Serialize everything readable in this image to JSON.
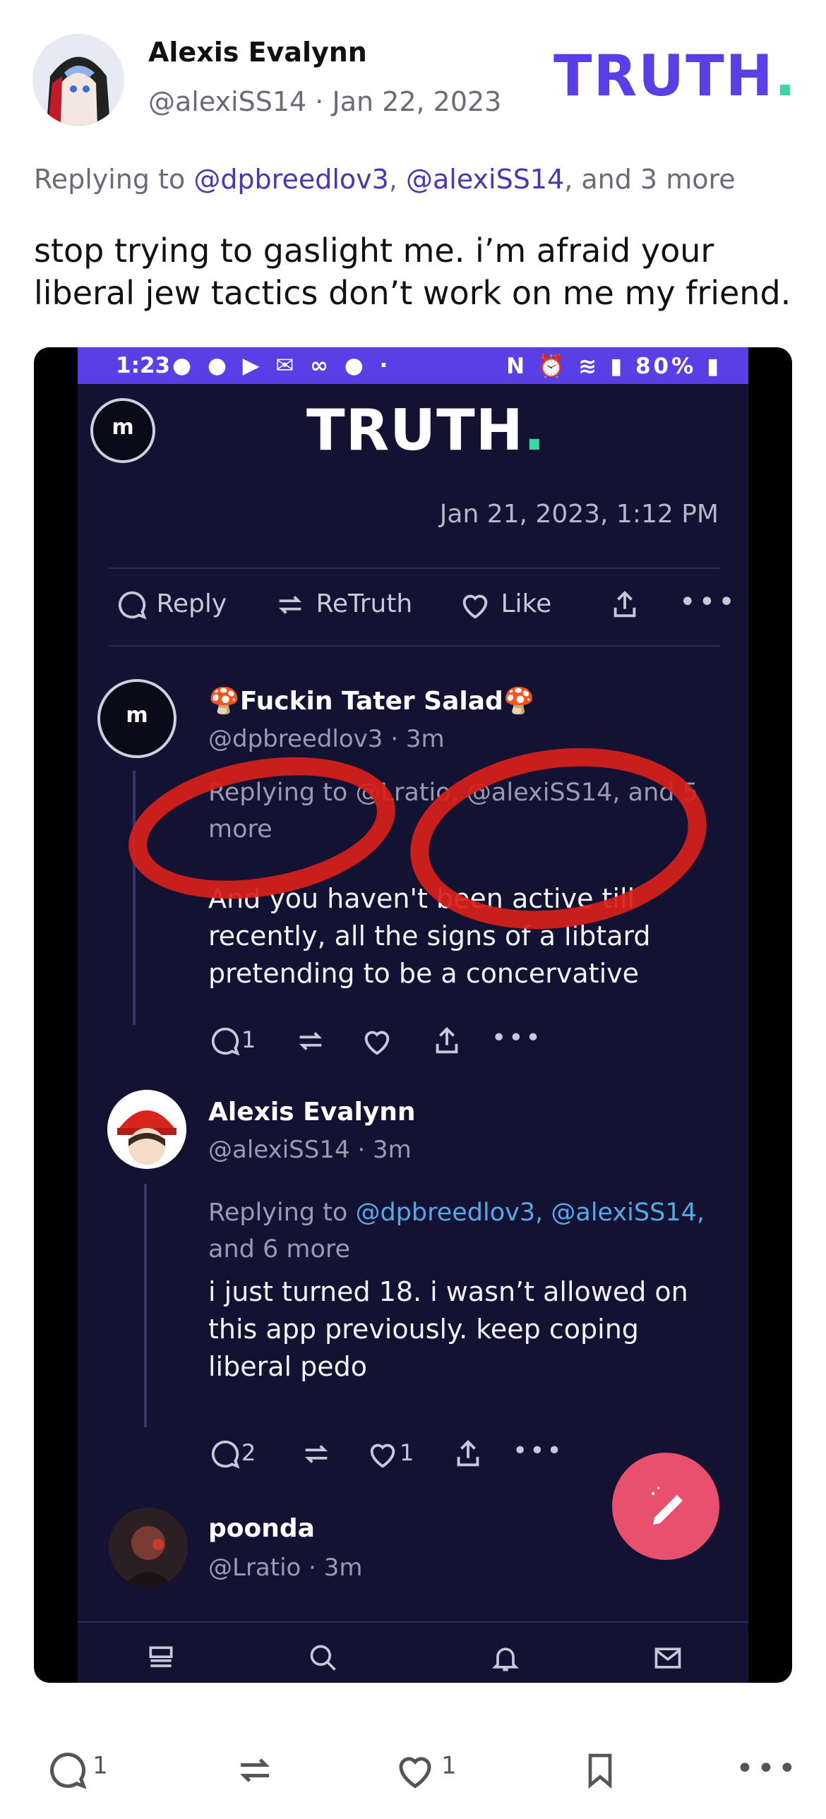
{
  "post": {
    "author_name": "Alexis Evalynn",
    "author_handle": "@alexiSS14",
    "separator": "·",
    "date": "Jan 22, 2023",
    "brand": "TRUTH",
    "brand_dot": ".",
    "replying_prefix": "Replying to ",
    "replying_mention_1": "@dpbreedlov3",
    "replying_sep": ", ",
    "replying_mention_2": "@alexiSS14",
    "replying_suffix": ", and 3 more",
    "text": "stop trying to gaslight me. i’m afraid your liberal jew tactics don’t work on me my friend."
  },
  "screenshot": {
    "status": {
      "time": "1:23",
      "battery": "80%"
    },
    "logo": "TRUTH",
    "logo_dot": ".",
    "crest_letter": "m",
    "timestamp": "Jan 21, 2023, 1:12 PM",
    "actions": {
      "reply": "Reply",
      "retruth": "ReTruth",
      "like": "Like"
    },
    "replies": [
      {
        "name": "Fuckin Tater Salad",
        "handle": "@dpbreedlov3 · 3m",
        "replying": "Replying to @Lratio, @alexiSS14, and 5 more",
        "text": "And you haven't been active till recently, all the signs of a libtard pretending to be a concervative",
        "reply_count": "1",
        "like_count": ""
      },
      {
        "name": "Alexis Evalynn",
        "handle": "@alexiSS14 · 3m",
        "replying_prefix": "Replying to ",
        "replying_links": "@dpbreedlov3, @alexiSS14,",
        "replying_suffix": "and 6 more",
        "text": "i just turned 18. i wasn’t allowed on this app previously. keep coping liberal pedo",
        "reply_count": "2",
        "like_count": "1"
      },
      {
        "name": "poonda",
        "handle": "@Lratio · 3m"
      }
    ]
  },
  "footer": {
    "reply_count": "1",
    "like_count": "1"
  },
  "colors": {
    "brand": "#5a3ee6",
    "brand_dot": "#3ad6a4",
    "mention": "#4a37b5",
    "fab": "#e8506d",
    "annotation": "#d8201a"
  }
}
